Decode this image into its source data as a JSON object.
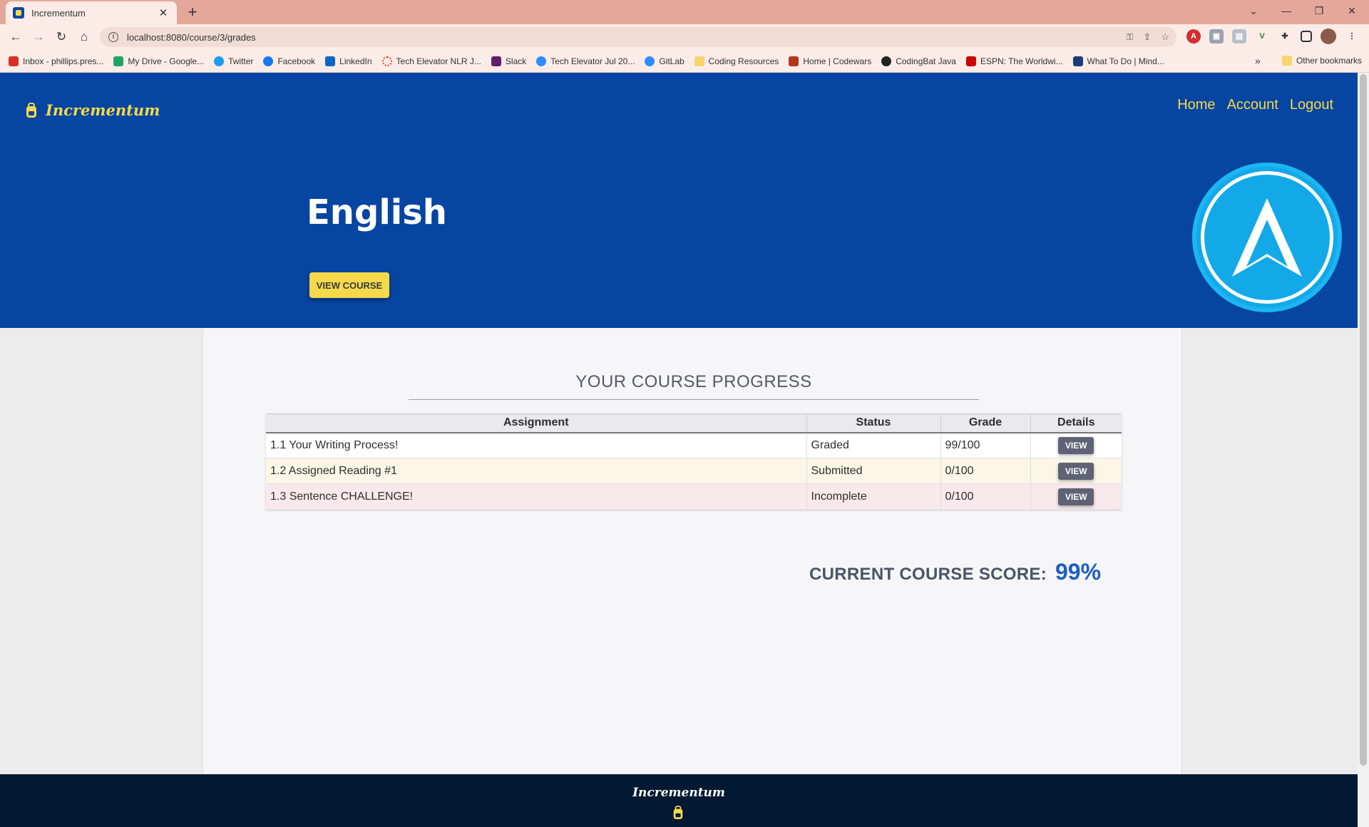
{
  "browser": {
    "tab_title": "Incrementum",
    "url": "localhost:8080/course/3/grades",
    "bookmarks": [
      {
        "label": "Inbox - phillips.pres...",
        "color": "#d93025"
      },
      {
        "label": "My Drive - Google...",
        "color": "#1fa463"
      },
      {
        "label": "Twitter",
        "color": "#1d9bf0"
      },
      {
        "label": "Facebook",
        "color": "#1877f2"
      },
      {
        "label": "LinkedIn",
        "color": "#0a66c2"
      },
      {
        "label": "Tech Elevator NLR J...",
        "color": "#e2493b"
      },
      {
        "label": "Slack",
        "color": "#611f69"
      },
      {
        "label": "Tech Elevator Jul 20...",
        "color": "#2d8cff"
      },
      {
        "label": "GitLab",
        "color": "#2d8cff"
      },
      {
        "label": "Coding Resources",
        "color": "#f7d56b"
      },
      {
        "label": "Home | Codewars",
        "color": "#b1361e"
      },
      {
        "label": "CodingBat Java",
        "color": "#222222"
      },
      {
        "label": "ESPN: The Worldwi...",
        "color": "#cc0000"
      },
      {
        "label": "What To Do | Mind...",
        "color": "#1b3b7a"
      }
    ],
    "other_bookmarks": "Other bookmarks"
  },
  "header": {
    "brand": "Incrementum",
    "nav": [
      "Home",
      "Account",
      "Logout"
    ]
  },
  "hero": {
    "course_title": "English",
    "view_course_label": "VIEW COURSE"
  },
  "progress": {
    "title": "YOUR COURSE PROGRESS",
    "columns": [
      "Assignment",
      "Status",
      "Grade",
      "Details"
    ],
    "rows": [
      {
        "assignment": "1.1 Your Writing Process!",
        "status": "Graded",
        "grade": "99/100",
        "action": "VIEW"
      },
      {
        "assignment": "1.2 Assigned Reading #1",
        "status": "Submitted",
        "grade": "0/100",
        "action": "VIEW"
      },
      {
        "assignment": "1.3 Sentence CHALLENGE!",
        "status": "Incomplete",
        "grade": "0/100",
        "action": "VIEW"
      }
    ]
  },
  "score": {
    "label": "CURRENT COURSE SCORE:",
    "value": "99%"
  },
  "footer": {
    "brand": "Incrementum"
  },
  "colors": {
    "hero_bg": "#0645a1",
    "accent_yellow": "#f5d94a",
    "footer_bg": "#031833",
    "score_blue": "#1c5fc4"
  }
}
